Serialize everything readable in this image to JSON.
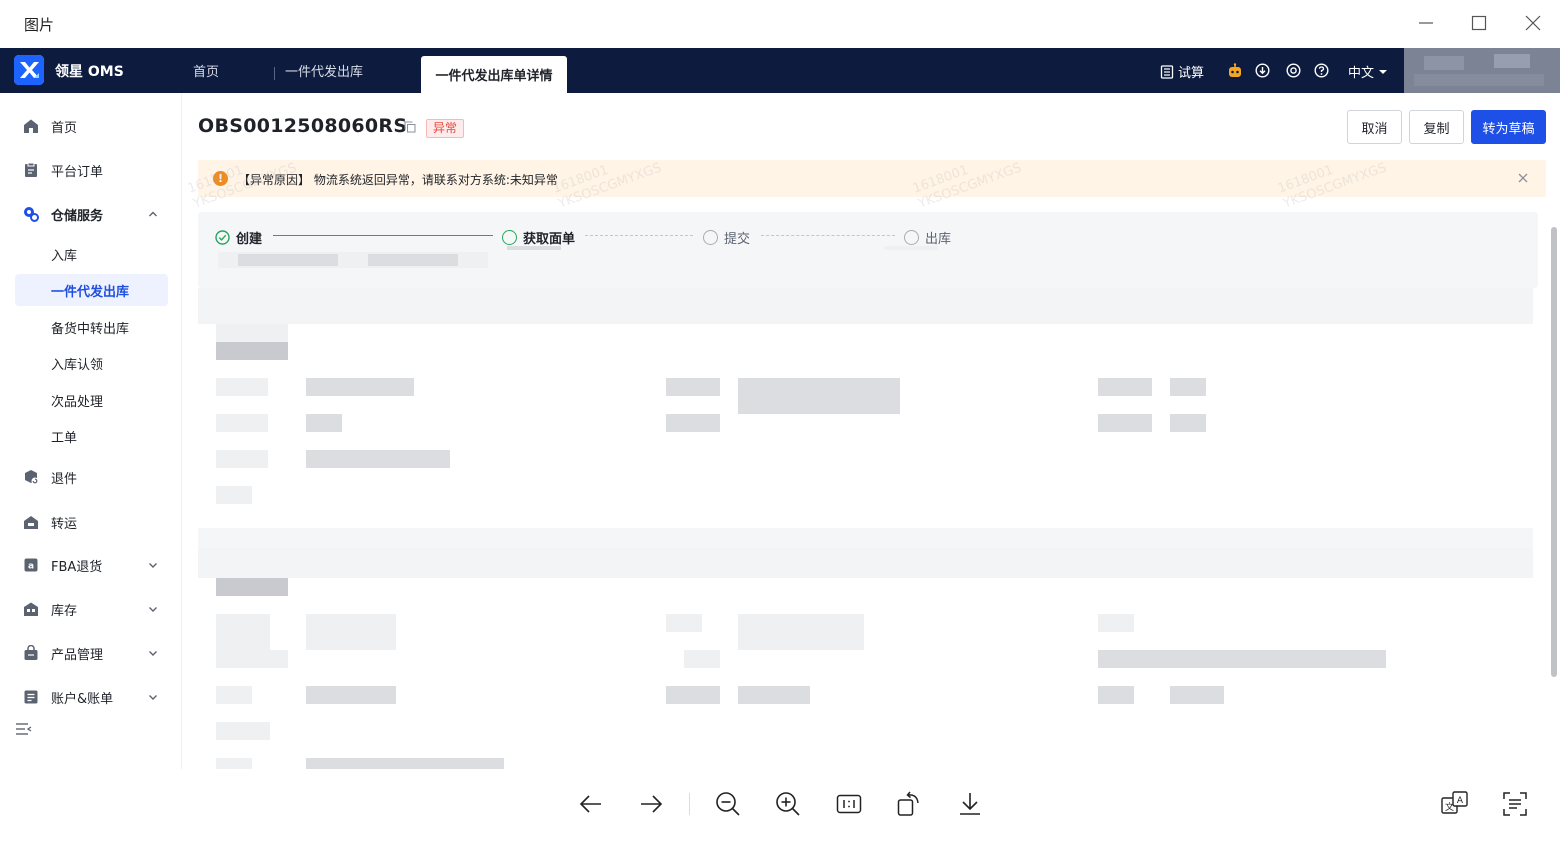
{
  "window": {
    "title": "图片"
  },
  "app": {
    "brand": "领星 OMS",
    "tabs": [
      {
        "label": "首页"
      },
      {
        "label": "一件代发出库"
      },
      {
        "label": "一件代发出库单详情"
      }
    ],
    "header_tools": {
      "trial": "试算",
      "language": "中文"
    }
  },
  "sidebar": {
    "items": [
      {
        "label": "首页",
        "icon": "home-icon"
      },
      {
        "label": "平台订单",
        "icon": "clipboard-icon"
      },
      {
        "label": "仓储服务",
        "icon": "warehouse-icon",
        "expanded": true,
        "children": [
          {
            "label": "入库"
          },
          {
            "label": "一件代发出库",
            "active": true
          },
          {
            "label": "备货中转出库"
          },
          {
            "label": "入库认领"
          },
          {
            "label": "次品处理"
          },
          {
            "label": "工单"
          }
        ]
      },
      {
        "label": "退件",
        "icon": "return-box-icon"
      },
      {
        "label": "转运",
        "icon": "transfer-icon"
      },
      {
        "label": "FBA退货",
        "icon": "amazon-icon"
      },
      {
        "label": "库存",
        "icon": "inventory-icon"
      },
      {
        "label": "产品管理",
        "icon": "product-bag-icon"
      },
      {
        "label": "账户&账单",
        "icon": "account-icon"
      }
    ]
  },
  "detail": {
    "order_no": "OBS0012508060RS",
    "status": "异常",
    "status_color": "#e84a3f",
    "buttons": {
      "cancel": "取消",
      "copy": "复制",
      "to_draft": "转为草稿"
    },
    "alert": {
      "text": "【异常原因】 物流系统返回异常，请联系对方系统:未知异常"
    },
    "steps": [
      {
        "label": "创建",
        "state": "done"
      },
      {
        "label": "获取面单",
        "state": "current"
      },
      {
        "label": "提交",
        "state": "pending"
      },
      {
        "label": "出库",
        "state": "pending"
      }
    ],
    "accent_color": "#1e4fe6",
    "success_color": "#2aa55a"
  }
}
